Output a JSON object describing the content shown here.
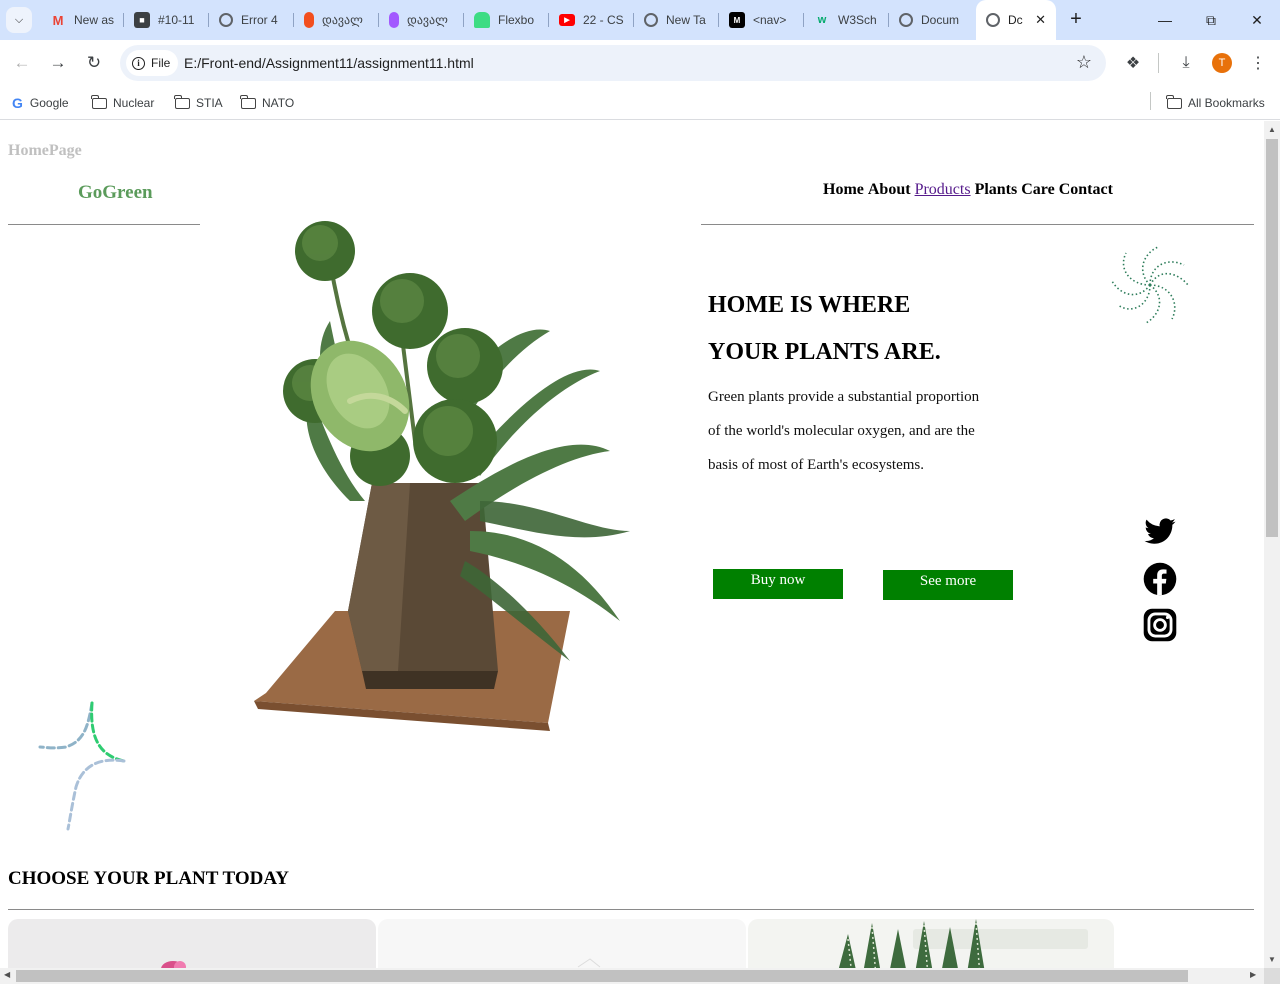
{
  "browser": {
    "tabs": [
      {
        "title": "New as",
        "icon": "gmail-icon",
        "color": "#ea4335"
      },
      {
        "title": "#10-11",
        "icon": "contact-icon",
        "color": "#3c4043"
      },
      {
        "title": "Error 4",
        "icon": "globe-icon",
        "color": "#5f6368"
      },
      {
        "title": "დავალ",
        "icon": "figma-icon",
        "color": "#f24e1e"
      },
      {
        "title": "დავალ",
        "icon": "figma-icon",
        "color": "#f24e1e"
      },
      {
        "title": "Flexbo",
        "icon": "android-icon",
        "color": "#3ddc84"
      },
      {
        "title": "22 - CS",
        "icon": "youtube-icon",
        "color": "#ff0000"
      },
      {
        "title": "New Ta",
        "icon": "globe-icon",
        "color": "#5f6368"
      },
      {
        "title": "<nav>",
        "icon": "mdn-icon",
        "color": "#000000"
      },
      {
        "title": "W3Sch",
        "icon": "w3schools-icon",
        "color": "#04aa6d"
      },
      {
        "title": "Docum",
        "icon": "globe-icon",
        "color": "#5f6368"
      },
      {
        "title": "Dc",
        "icon": "globe-icon",
        "color": "#5f6368"
      }
    ],
    "site_chip": "File",
    "url": "E:/Front-end/Assignment11/assignment11.html",
    "profile_initial": "T",
    "bookmarks": [
      {
        "label": "Google",
        "icon": "google-icon"
      },
      {
        "label": "Nuclear",
        "icon": "folder-icon"
      },
      {
        "label": "STIA",
        "icon": "folder-icon"
      },
      {
        "label": "NATO",
        "icon": "folder-icon"
      }
    ],
    "all_bookmarks": "All Bookmarks"
  },
  "page": {
    "homepage_label": "HomePage",
    "logo": "GoGreen",
    "nav": [
      "Home",
      "About",
      "Products",
      "Plants Care",
      "Contact"
    ],
    "hero": {
      "title_line1": "HOME IS WHERE",
      "title_line2": "YOUR PLANTS ARE.",
      "text_line1": "Green plants provide a substantial proportion",
      "text_line2": "of the world's molecular oxygen, and are the",
      "text_line3": "basis of most of Earth's ecosystems.",
      "buy_button": "Buy now",
      "more_button": "See more"
    },
    "social": [
      "twitter-icon",
      "facebook-icon",
      "instagram-icon"
    ],
    "section_title": "CHOOSE YOUR PLANT TODAY",
    "colors": {
      "button": "#008000",
      "logo": "#5b9b5b",
      "visited_link": "#551a8b"
    }
  }
}
